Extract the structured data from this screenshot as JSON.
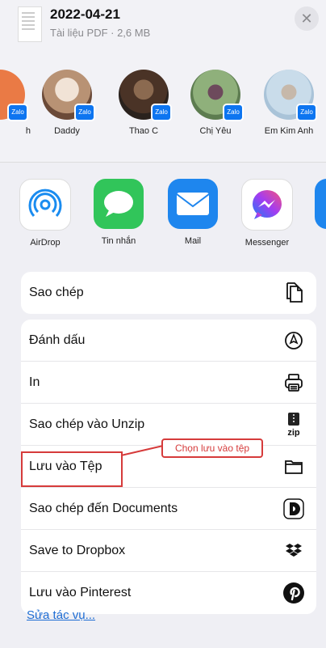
{
  "header": {
    "title": "2022-04-21",
    "subtitle": "Tài liệu PDF · 2,6 MB",
    "close_icon": "x"
  },
  "people": [
    {
      "name": "h",
      "badge": "Zalo"
    },
    {
      "name": "Daddy",
      "badge": "Zalo"
    },
    {
      "name": "Thao C",
      "badge": "Zalo"
    },
    {
      "name": "Chị Yêu",
      "badge": "Zalo"
    },
    {
      "name": "Em Kim Anh",
      "badge": "Zalo"
    }
  ],
  "apps": [
    {
      "label": "AirDrop"
    },
    {
      "label": "Tin nhắn"
    },
    {
      "label": "Mail"
    },
    {
      "label": "Messenger"
    }
  ],
  "actions_primary": [
    {
      "label": "Sao chép",
      "icon": "copy-icon"
    }
  ],
  "actions": [
    {
      "label": "Đánh dấu",
      "icon": "markup-icon"
    },
    {
      "label": "In",
      "icon": "printer-icon"
    },
    {
      "label": "Sao chép vào Unzip",
      "icon": "zip-icon"
    },
    {
      "label": "Lưu vào Tệp",
      "icon": "folder-icon"
    },
    {
      "label": "Sao chép đến Documents",
      "icon": "documents-icon"
    },
    {
      "label": "Save to Dropbox",
      "icon": "dropbox-icon"
    },
    {
      "label": "Lưu vào Pinterest",
      "icon": "pinterest-icon"
    }
  ],
  "zip_icon_text": "zip",
  "edit_label": "Sửa tác vụ...",
  "annotation": {
    "label": "Chọn lưu vào tệp"
  },
  "colors": {
    "accent": "#1f6ed4",
    "annotation": "#d63b3b",
    "zalo": "#0d75f0"
  }
}
